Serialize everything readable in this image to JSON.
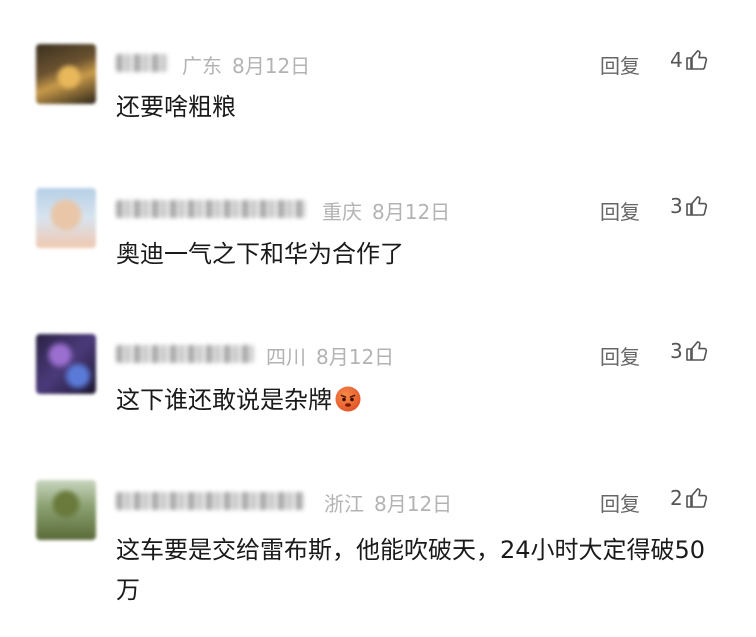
{
  "comments": [
    {
      "location": "广东",
      "date": "8月12日",
      "reply_label": "回复",
      "likes": "4",
      "text": "还要啥粗粮"
    },
    {
      "location": "重庆",
      "date": "8月12日",
      "reply_label": "回复",
      "likes": "3",
      "text": "奥迪一气之下和华为合作了"
    },
    {
      "location": "四川",
      "date": "8月12日",
      "reply_label": "回复",
      "likes": "3",
      "text": "这下谁还敢说是杂牌",
      "emoji": "angry-face-emoji"
    },
    {
      "location": "浙江",
      "date": "8月12日",
      "reply_label": "回复",
      "likes": "2",
      "text": "这车要是交给雷布斯，他能吹破天，24小时大定得破50万"
    }
  ],
  "icons": {
    "like": "thumbs-up-icon",
    "emoji": "angry-face-emoji"
  },
  "colors": {
    "meta": "#b3b3b3",
    "text": "#1a1a1a",
    "reply": "#666666"
  }
}
